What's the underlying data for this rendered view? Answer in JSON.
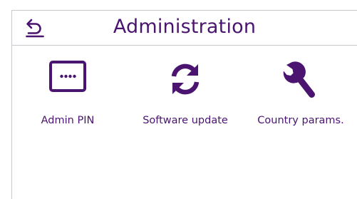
{
  "header": {
    "title": "Administration"
  },
  "icons": {
    "back": "back-arrow-icon",
    "pin": "pin-dots-icon",
    "refresh": "refresh-icon",
    "wrench": "wrench-icon"
  },
  "colors": {
    "accent": "#4a1470",
    "border": "#c8c8cc",
    "background": "#ffffff"
  },
  "tiles": [
    {
      "label": "Admin PIN"
    },
    {
      "label": "Software update"
    },
    {
      "label": "Country params."
    }
  ]
}
